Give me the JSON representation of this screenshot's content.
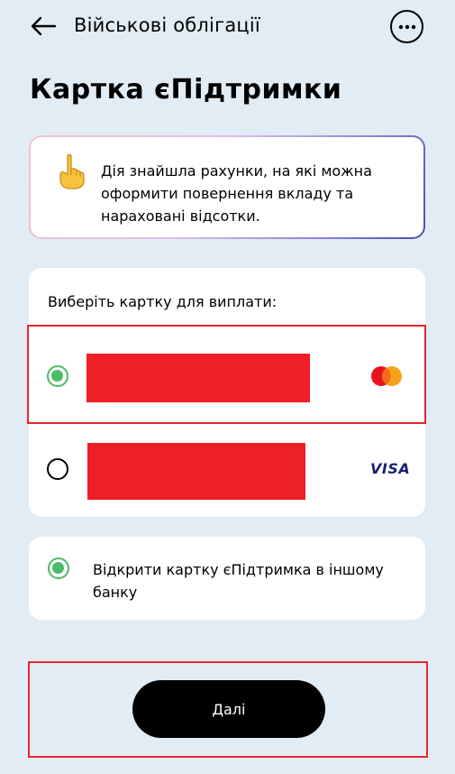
{
  "header": {
    "back_icon": "arrow-left-icon",
    "title": "Військові облігації",
    "more_icon": "more-horizontal-icon"
  },
  "page": {
    "title": "Картка єПідтримки"
  },
  "info": {
    "icon": "pointing-up-hand-emoji",
    "text": "Дія знайшла рахунки, на які можна оформити повернення вкладу та нараховані відсотки."
  },
  "cards": {
    "label": "Виберіть картку для виплати:",
    "items": [
      {
        "number": "",
        "redacted": true,
        "brand": "mastercard",
        "selected": true
      },
      {
        "number": "",
        "redacted": true,
        "brand": "VISA",
        "selected": false
      }
    ]
  },
  "other_bank": {
    "selected": true,
    "text": "Відкрити картку єПідтримка в іншому банку"
  },
  "footer": {
    "next_label": "Далі"
  },
  "colors": {
    "background": "#e2ecf4",
    "radio_checked": "#4cbb66",
    "redaction": "#ee1f26",
    "annotation_border": "#e8252e",
    "button": "#000000"
  }
}
